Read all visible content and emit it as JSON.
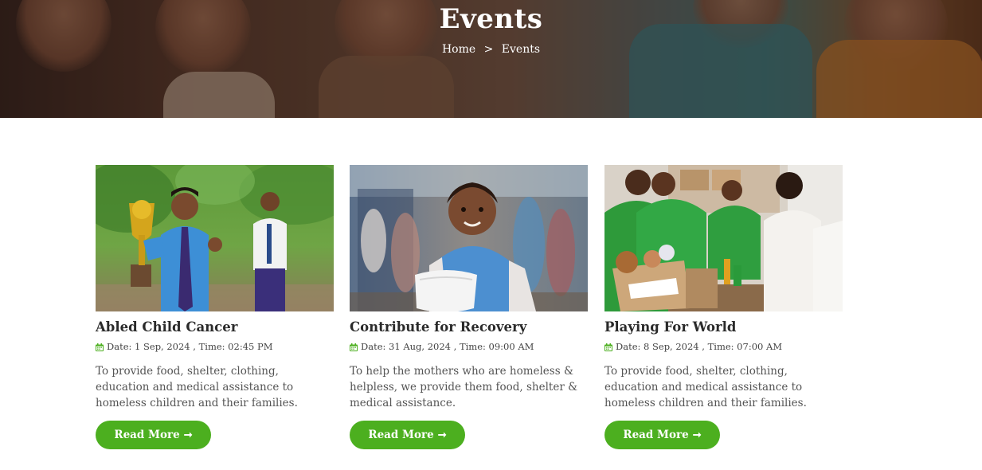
{
  "hero": {
    "title": "Events",
    "breadcrumb": {
      "home": "Home",
      "separator": ">",
      "current": "Events"
    }
  },
  "theme": {
    "accent": "#4caf1f",
    "text": "#333333",
    "hero_overlay": "#2a1a14"
  },
  "events": [
    {
      "title": "Abled Child Cancer",
      "meta": "Date: 1 Sep, 2024 , Time: 02:45 PM",
      "description": "To provide food, shelter, clothing, education and medical assistance to homeless children and their families.",
      "button": "Read More",
      "image_subject": "boy-with-trophy-photo"
    },
    {
      "title": "Contribute for Recovery",
      "meta": "Date: 31 Aug, 2024 , Time: 09:00 AM",
      "description": "To help the mothers who are homeless & helpless, we provide them food, shelter & medical assistance.",
      "button": "Read More",
      "image_subject": "girl-holding-food-bag-photo"
    },
    {
      "title": "Playing For World",
      "meta": "Date: 8 Sep, 2024 , Time: 07:00 AM",
      "description": "To provide food, shelter, clothing, education and medical assistance to homeless children and their families.",
      "button": "Read More",
      "image_subject": "volunteers-donations-photo"
    }
  ]
}
